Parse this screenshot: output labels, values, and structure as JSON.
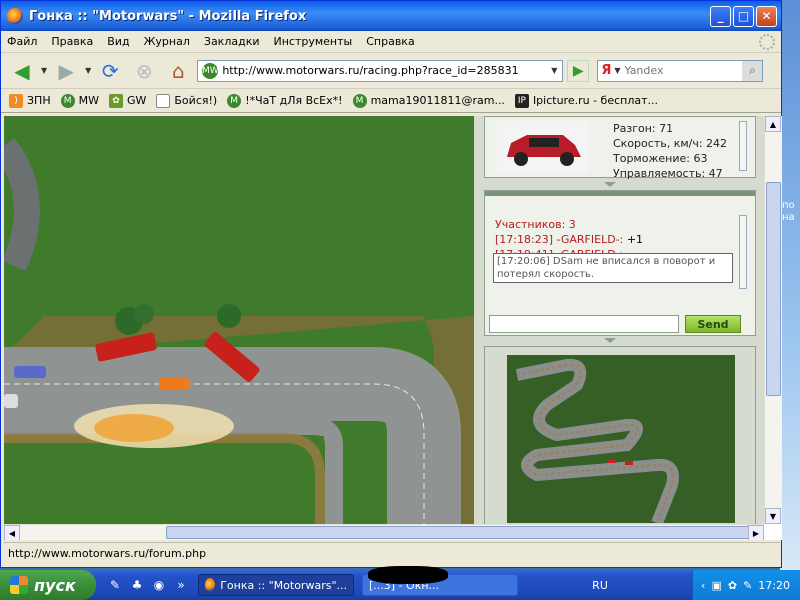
{
  "window": {
    "title": "Гонка :: \"Motorwars\" - Mozilla Firefox"
  },
  "menu": [
    "Файл",
    "Правка",
    "Вид",
    "Журнал",
    "Закладки",
    "Инструменты",
    "Справка"
  ],
  "nav": {
    "url": "http://www.motorwars.ru/racing.php?race_id=285831",
    "search_engine": "Я",
    "search_placeholder": "Yandex"
  },
  "bookmarks": [
    {
      "label": "ЗПН",
      "icon": "rss-icon"
    },
    {
      "label": "MW",
      "icon": "mw-icon"
    },
    {
      "label": "GW",
      "icon": "leaf-icon"
    },
    {
      "label": "Бойся!)",
      "icon": "page-icon"
    },
    {
      "label": "!*ЧаТ дЛя ВсЕх*!",
      "icon": "mw-icon"
    },
    {
      "label": "mama19011811@ram...",
      "icon": "mw-icon"
    },
    {
      "label": "Ipicture.ru - бесплат...",
      "icon": "ipicture-icon"
    }
  ],
  "car_stats": [
    "Разгон: 71",
    "Скорость, км/ч: 242",
    "Торможение: 63",
    "Управляемость: 47"
  ],
  "chat": {
    "participants": "Участников: 3",
    "line1_time": "[17:18:23] -GARFIELD-:",
    "line1_msg": "+1",
    "line2": "[17:19:41] -GARFIELD-:",
    "tooltip": "[17:20:06] DSam не вписался в поворот и потерял скорость.",
    "input_value": "",
    "send_label": "Send"
  },
  "status": "http://www.motorwars.ru/forum.php",
  "taskbar": {
    "start_label": "пуск",
    "task1": "Гонка :: \"Motorwars\"...",
    "task2": "[...3] - Окн...",
    "lang": "RU",
    "clock": "17:20"
  },
  "desktop_snip": "по\nна"
}
